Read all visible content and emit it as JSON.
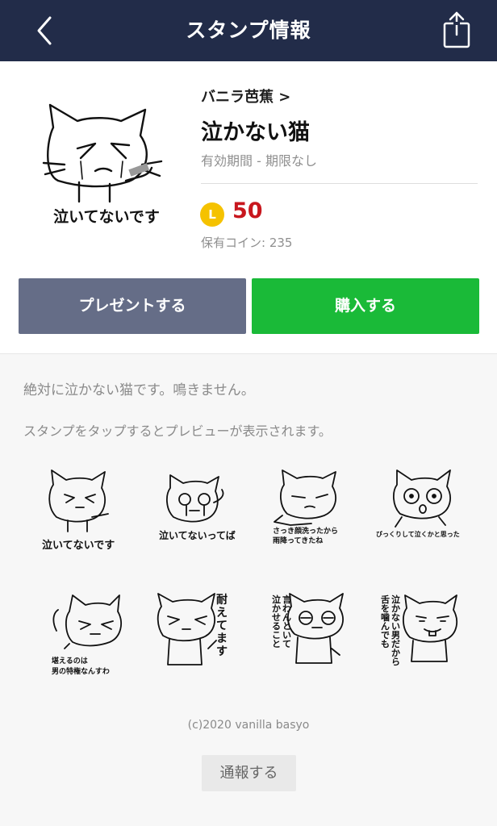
{
  "nav": {
    "title": "スタンプ情報",
    "back_icon": "chevron-left-icon",
    "share_icon": "share-icon"
  },
  "product": {
    "main_sticker_caption": "泣いてないです",
    "author": "バニラ芭蕉 >",
    "title": "泣かない猫",
    "validity": "有効期間 - 期限なし",
    "coin_symbol": "L",
    "price": "50",
    "owned_coins": "保有コイン: 235"
  },
  "actions": {
    "present_label": "プレゼントする",
    "buy_label": "購入する"
  },
  "description": "絶対に泣かない猫です。鳴きません。",
  "preview_hint": "スタンプをタップするとプレビューが表示されます。",
  "stickers": [
    {
      "caption": "泣いてないです"
    },
    {
      "caption": "泣いてないってば"
    },
    {
      "caption_line1": "さっき顔洗ったから",
      "caption_line2": "雨降ってきたね"
    },
    {
      "caption": "びっくりして泣くかと思った"
    },
    {
      "caption_line1": "堪えるのは",
      "caption_line2": "男の特権なんすわ"
    },
    {
      "caption": "耐えてます"
    },
    {
      "caption_col1": "泣かせること",
      "caption_col2": "言わんといて"
    },
    {
      "caption_col1": "舌を噛んでも",
      "caption_col2": "泣かない男だから"
    }
  ],
  "footer": {
    "copyright": "(c)2020 vanilla basyo",
    "report_label": "通報する"
  },
  "colors": {
    "navbar": "#222c49",
    "buy": "#1aba38",
    "present": "#656d87",
    "price": "#c8171e",
    "coin": "#f5c200"
  }
}
